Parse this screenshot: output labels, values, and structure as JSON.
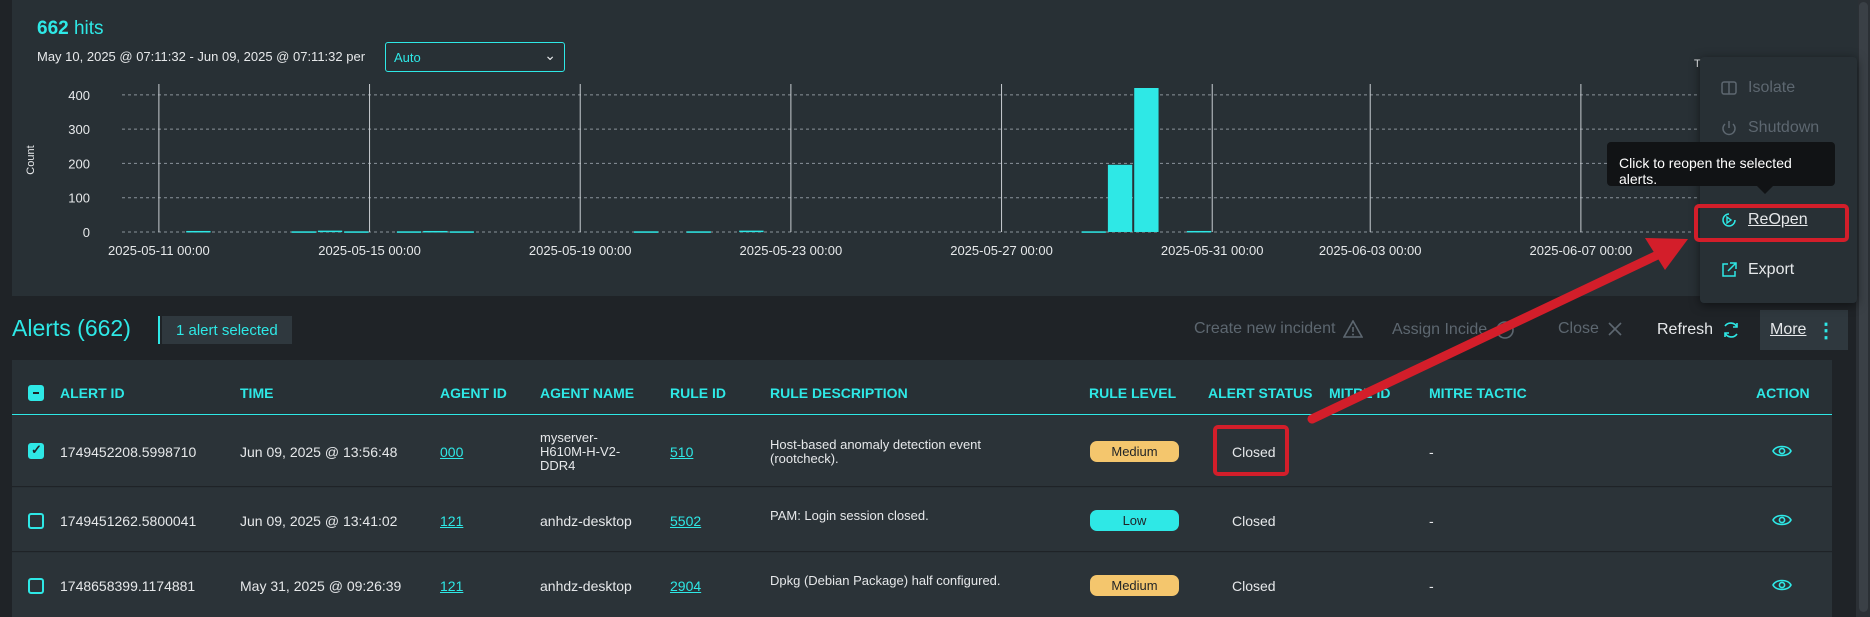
{
  "histogram": {
    "hits_count": "662",
    "hits_label": "hits",
    "date_range": "May 10, 2025 @ 07:11:32 - Jun 09, 2025 @ 07:11:32 per",
    "interval": "Auto",
    "partial_label": "T"
  },
  "chart_data": {
    "type": "bar",
    "ylabel": "Count",
    "ylim": [
      0,
      420
    ],
    "yticks": [
      0,
      100,
      200,
      300,
      400
    ],
    "xticks": [
      "2025-05-11 00:00",
      "2025-05-15 00:00",
      "2025-05-19 00:00",
      "2025-05-23 00:00",
      "2025-05-27 00:00",
      "2025-05-31 00:00",
      "2025-06-03 00:00",
      "2025-06-07 00:00"
    ],
    "grid": true,
    "bar_color": "#2ee8e6",
    "bars": [
      {
        "x": "2025-05-11 12:00",
        "value": 3
      },
      {
        "x": "2025-05-13 12:00",
        "value": 2
      },
      {
        "x": "2025-05-14 00:00",
        "value": 4
      },
      {
        "x": "2025-05-14 12:00",
        "value": 2
      },
      {
        "x": "2025-05-15 12:00",
        "value": 2
      },
      {
        "x": "2025-05-16 00:00",
        "value": 3
      },
      {
        "x": "2025-05-16 12:00",
        "value": 2
      },
      {
        "x": "2025-05-20 00:00",
        "value": 2
      },
      {
        "x": "2025-05-21 00:00",
        "value": 2
      },
      {
        "x": "2025-05-22 00:00",
        "value": 4
      },
      {
        "x": "2025-05-28 12:00",
        "value": 2
      },
      {
        "x": "2025-05-29 00:00",
        "value": 196
      },
      {
        "x": "2025-05-29 12:00",
        "value": 420
      },
      {
        "x": "2025-05-30 12:00",
        "value": 3
      }
    ]
  },
  "alerts": {
    "title": "Alerts (662)",
    "selected": "1 alert selected",
    "toolbar": {
      "create_incident": "Create new incident",
      "assign_incident": "Assign Incide",
      "close": "Close",
      "refresh": "Refresh",
      "more": "More"
    },
    "columns": [
      "ALERT ID",
      "TIME",
      "AGENT ID",
      "AGENT NAME",
      "RULE ID",
      "RULE DESCRIPTION",
      "RULE LEVEL",
      "ALERT STATUS",
      "MITRE ID",
      "MITRE TACTIC",
      "ACTION"
    ],
    "rows": [
      {
        "checked": true,
        "alert_id": "1749452208.5998710",
        "time": "Jun 09, 2025 @ 13:56:48",
        "agent_id": "000",
        "agent_name": "myserver-\nH610M-H-V2-\nDDR4",
        "rule_id": "510",
        "rule_description": "Host-based anomaly detection event\n(rootcheck).",
        "rule_level": "Medium",
        "alert_status": "Closed",
        "mitre_id": "",
        "mitre_tactic": "-"
      },
      {
        "checked": false,
        "alert_id": "1749451262.5800041",
        "time": "Jun 09, 2025 @ 13:41:02",
        "agent_id": "121",
        "agent_name": "anhdz-desktop",
        "rule_id": "5502",
        "rule_description": "PAM: Login session closed.",
        "rule_level": "Low",
        "alert_status": "Closed",
        "mitre_id": "",
        "mitre_tactic": "-"
      },
      {
        "checked": false,
        "alert_id": "1748658399.1174881",
        "time": "May 31, 2025 @ 09:26:39",
        "agent_id": "121",
        "agent_name": "anhdz-desktop",
        "rule_id": "2904",
        "rule_description": "Dpkg (Debian Package) half configured.",
        "rule_level": "Medium",
        "alert_status": "Closed",
        "mitre_id": "",
        "mitre_tactic": "-"
      }
    ]
  },
  "more_menu": {
    "isolate": "Isolate",
    "shutdown": "Shutdown",
    "reopen": "ReOpen",
    "export": "Export",
    "tooltip": "Click to reopen the selected alerts."
  },
  "colors": {
    "accent": "#2ee8e6",
    "annotation": "#d31e2a",
    "medium": "#f4c66d",
    "low": "#2ee8e6"
  }
}
